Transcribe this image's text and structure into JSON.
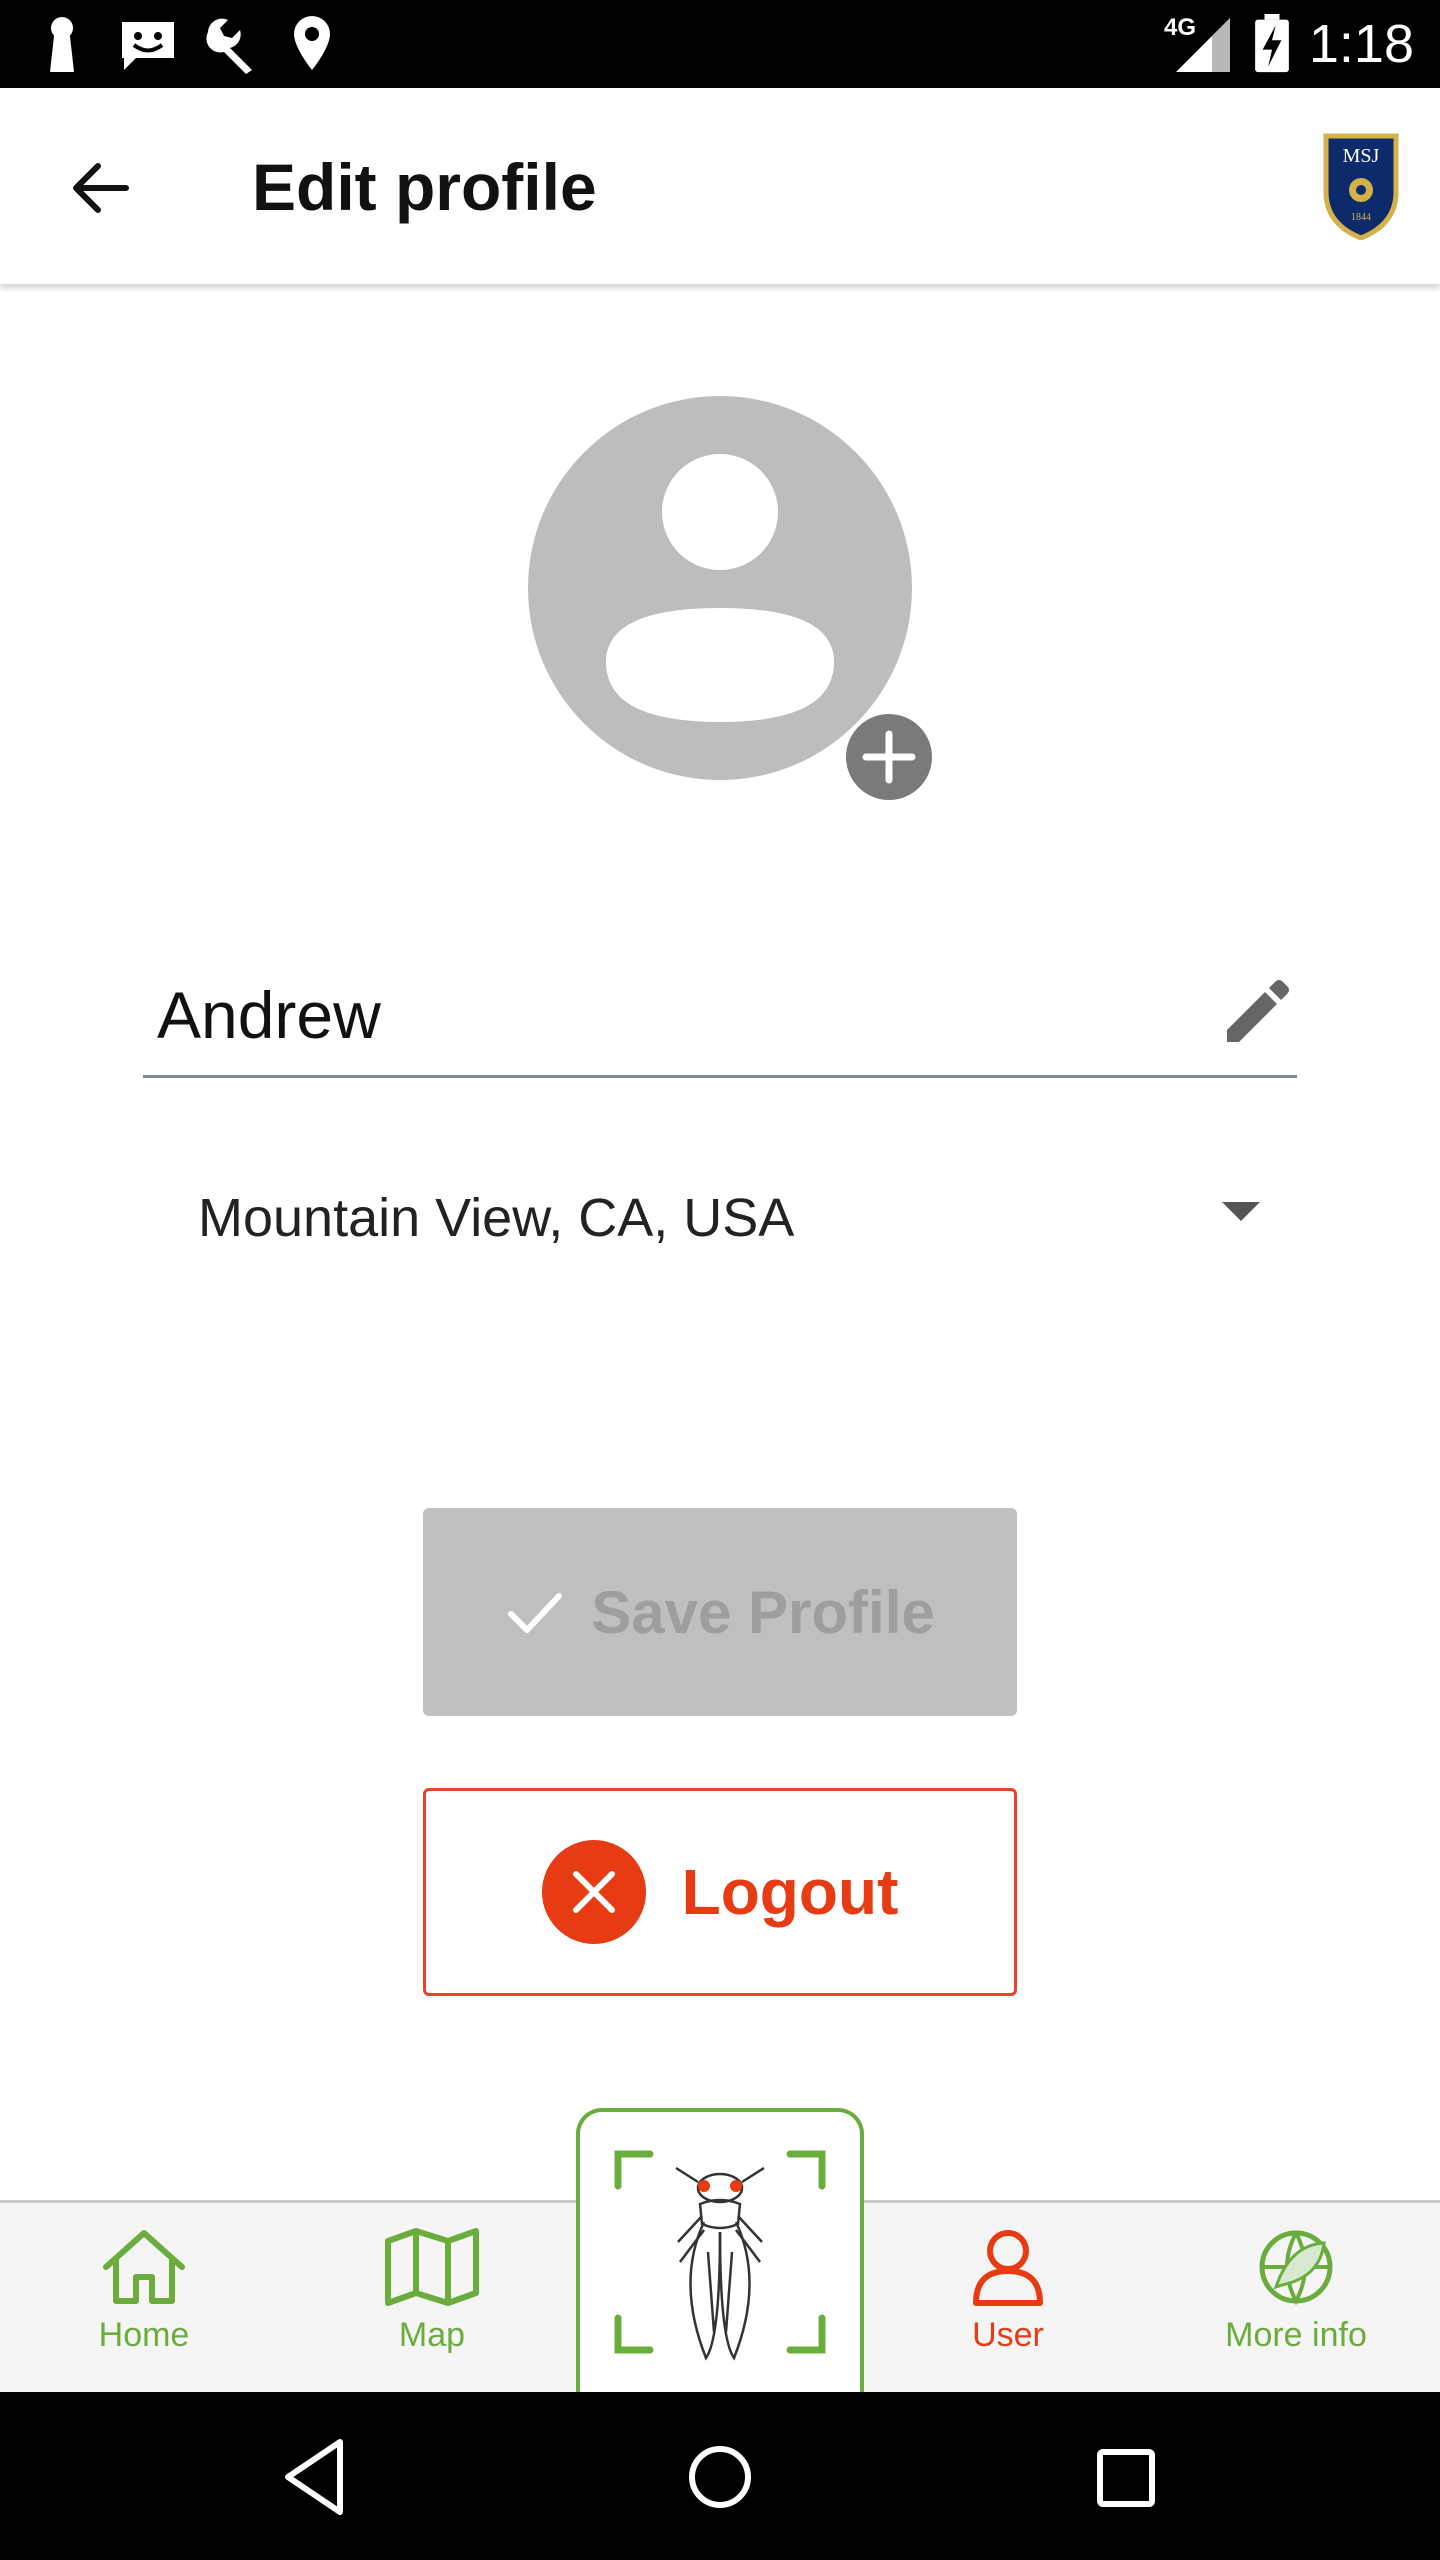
{
  "status_bar": {
    "time": "1:18",
    "network": "4G",
    "icons": [
      "keyhole-icon",
      "message-icon",
      "wrench-icon",
      "location-pin-icon",
      "signal-icon",
      "battery-charging-icon"
    ]
  },
  "app_bar": {
    "title": "Edit profile",
    "back_icon": "arrow-back-icon",
    "logo_text": "MSJ",
    "logo_year": "1844"
  },
  "profile": {
    "avatar_icon": "person-placeholder-icon",
    "add_photo_icon": "plus-icon",
    "name_value": "Andrew",
    "edit_icon": "pencil-icon",
    "location": "Mountain View, CA, USA"
  },
  "actions": {
    "save_label": "Save Profile",
    "logout_label": "Logout"
  },
  "bottom_nav": {
    "items": [
      {
        "label": "Home",
        "icon": "home-icon"
      },
      {
        "label": "Map",
        "icon": "map-icon"
      },
      {
        "label": "",
        "icon": "cicada-scan-icon"
      },
      {
        "label": "User",
        "icon": "user-icon"
      },
      {
        "label": "More info",
        "icon": "globe-leaf-icon"
      }
    ]
  },
  "colors": {
    "accent_green": "#6aad3c",
    "accent_red": "#e63b13",
    "disabled_grey": "#bfbfbf",
    "avatar_grey": "#bdbdbd"
  }
}
